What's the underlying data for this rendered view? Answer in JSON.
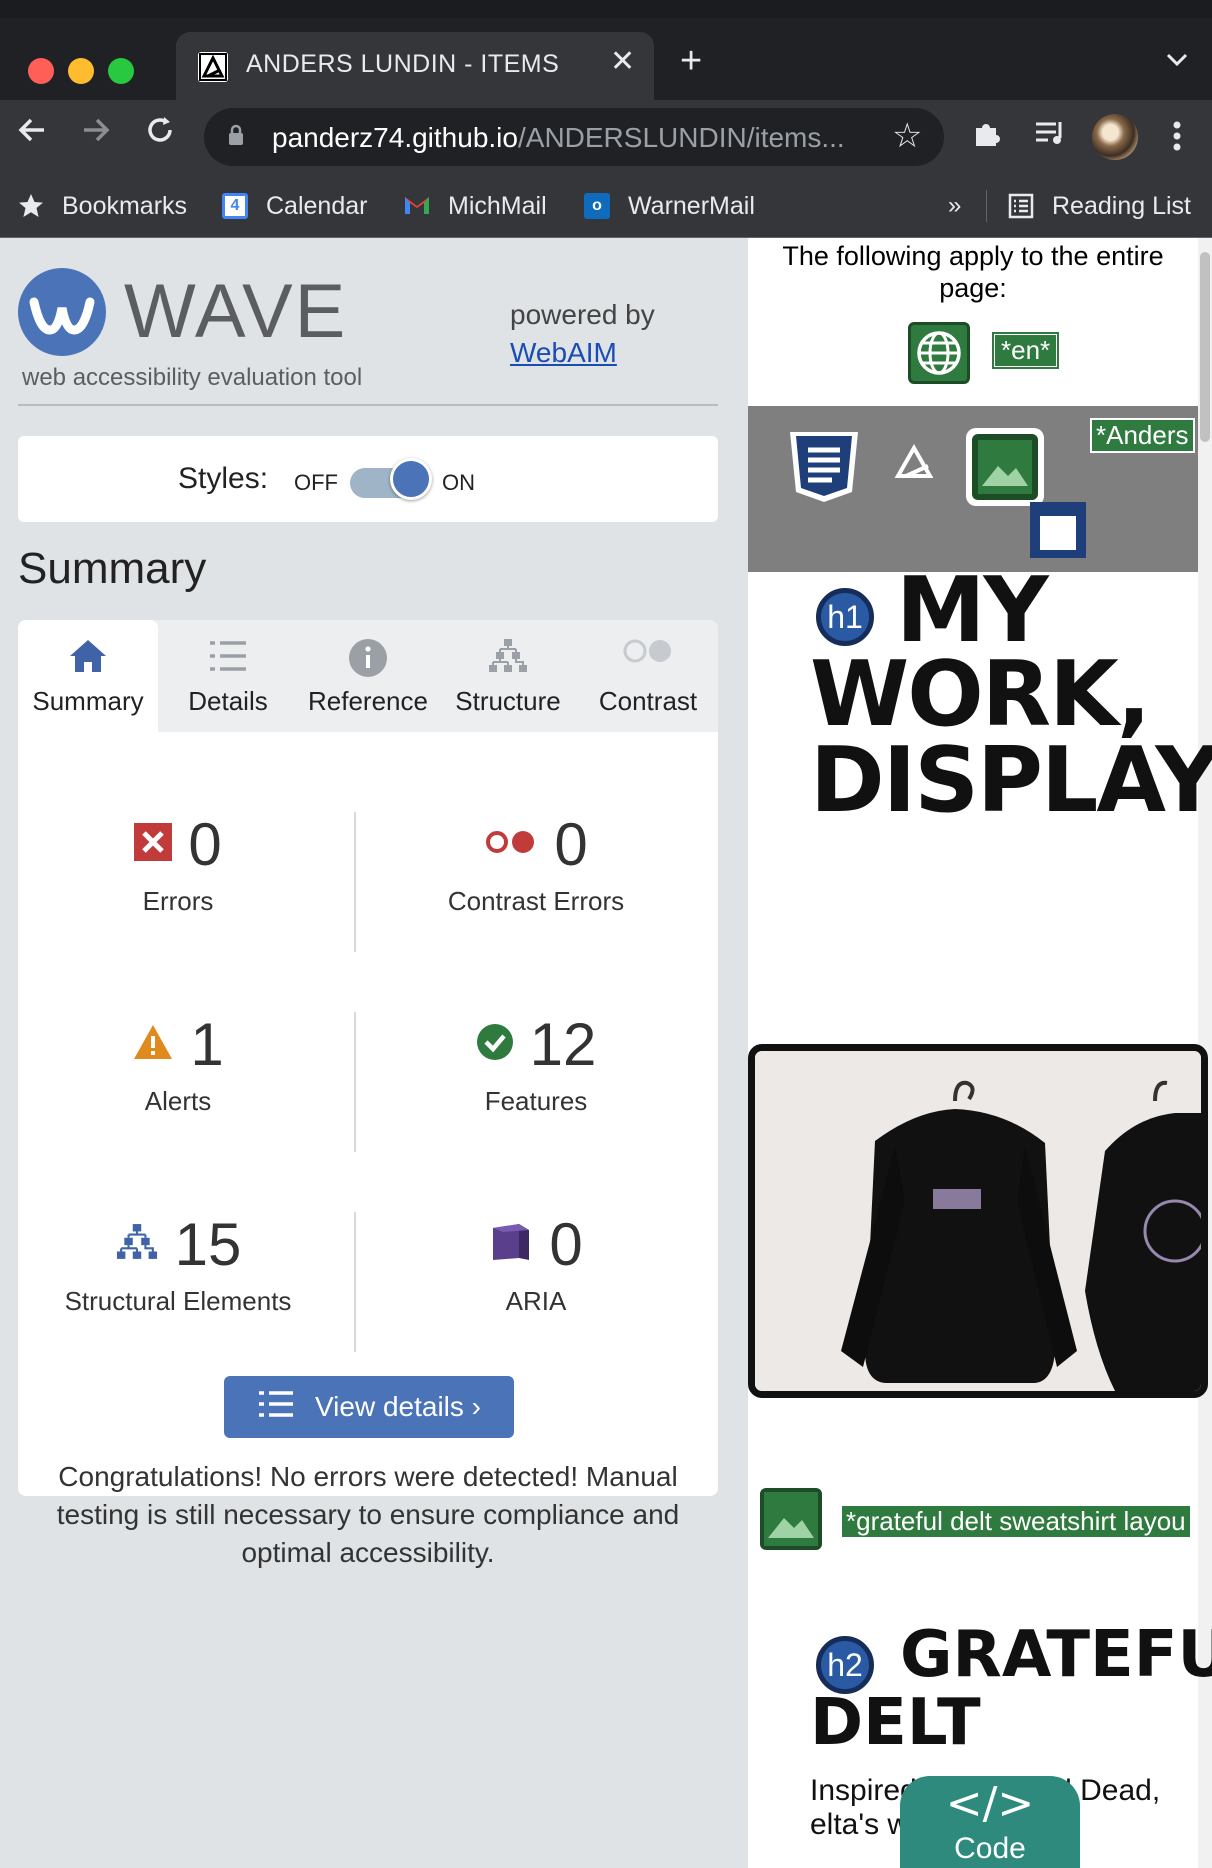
{
  "browser": {
    "tab_title": "ANDERS LUNDIN - ITEMS",
    "url_host": "panderz74.github.io",
    "url_path": "/ANDERSLUNDIN/items...",
    "bookmarks": [
      {
        "label": "Bookmarks",
        "icon": "star-icon"
      },
      {
        "label": "Calendar",
        "icon": "calendar-icon"
      },
      {
        "label": "MichMail",
        "icon": "gmail-icon"
      },
      {
        "label": "WarnerMail",
        "icon": "outlook-icon"
      }
    ],
    "overflow": "»",
    "reading_list": "Reading List"
  },
  "wave": {
    "logo_word": "WAVE",
    "logo_sub": "web accessibility evaluation tool",
    "powered_by": "powered by",
    "powered_link": "WebAIM",
    "styles_label": "Styles:",
    "styles_off": "OFF",
    "styles_on": "ON",
    "styles_state": "on",
    "summary_heading": "Summary",
    "tabs": [
      {
        "label": "Summary",
        "icon": "home-icon",
        "active": true
      },
      {
        "label": "Details",
        "icon": "list-icon"
      },
      {
        "label": "Reference",
        "icon": "info-icon"
      },
      {
        "label": "Structure",
        "icon": "structure-icon"
      },
      {
        "label": "Contrast",
        "icon": "contrast-icon"
      }
    ],
    "stats": {
      "errors": {
        "value": "0",
        "label": "Errors"
      },
      "contrast": {
        "value": "0",
        "label": "Contrast Errors"
      },
      "alerts": {
        "value": "1",
        "label": "Alerts"
      },
      "features": {
        "value": "12",
        "label": "Features"
      },
      "structural": {
        "value": "15",
        "label": "Structural Elements"
      },
      "aria": {
        "value": "0",
        "label": "ARIA"
      }
    },
    "view_details": "View details ›",
    "congrats": "Congratulations! No errors were detected! Manual testing is still necessary to ensure compliance and optimal accessibility."
  },
  "preview": {
    "applies_text": "The following apply to the entire page:",
    "lang_tag": "*en*",
    "anders_tag": "*Anders",
    "h1_badge": "h1",
    "h1_lines": [
      "MY",
      "WORK,",
      "DISPLAY"
    ],
    "alt_tag": "*grateful delt sweatshirt layou",
    "h2_badge": "h2",
    "h2_lines": [
      "GRATEFU",
      "DELT"
    ],
    "para": "Inspired by Grateful Dead, elta's winter n",
    "code_btn": "Code",
    "code_glyph": "</>"
  },
  "colors": {
    "wave_blue": "#4a73b8",
    "error_red": "#c23b3b",
    "alert_orange": "#e08a1e",
    "feature_green": "#2f7a3f",
    "aria_purple": "#5a3f8c"
  }
}
